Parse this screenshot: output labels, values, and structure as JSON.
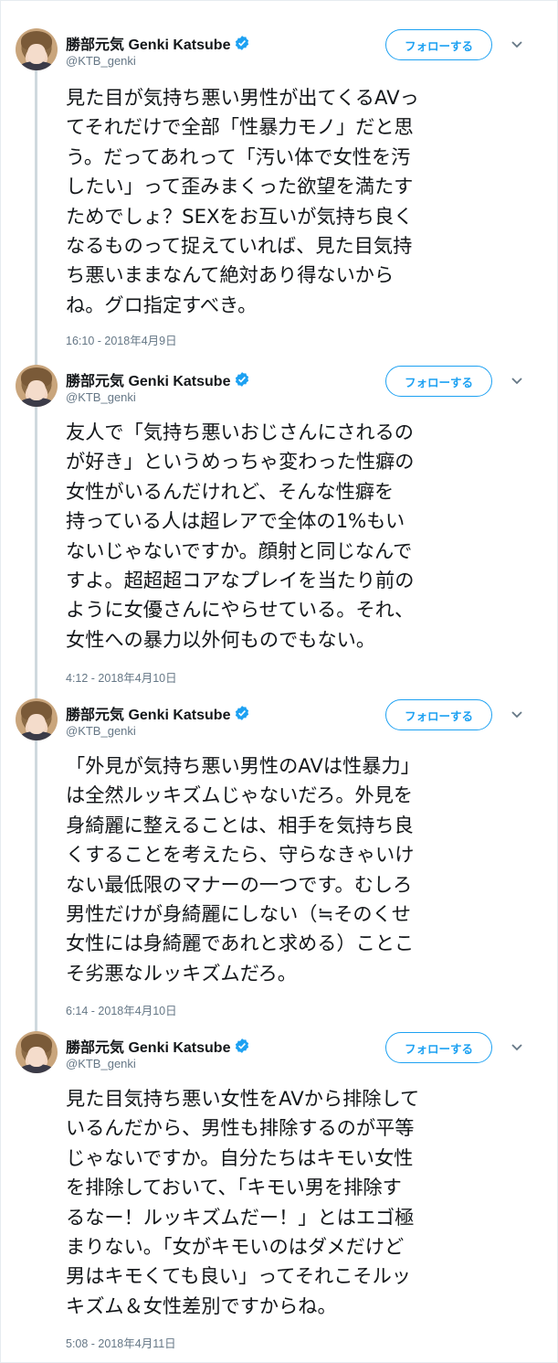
{
  "author": {
    "name": "勝部元気 Genki Katsube",
    "handle": "@KTB_genki",
    "verified": true
  },
  "follow_label": "フォローする",
  "icons": {
    "verified": "verified-badge-icon",
    "menu": "chevron-down-icon"
  },
  "colors": {
    "accent": "#1da1f2",
    "text": "#14171a",
    "muted": "#657786",
    "thread": "#cfd9de"
  },
  "tweets": [
    {
      "text": "見た目が気持ち悪い男性が出てくるAVっ\nてそれだけで全部「性暴力モノ」だと思\nう。だってあれって「汚い体で女性を汚\nしたい」って歪みまくった欲望を満たす\nためでしょ？SEXをお互いが気持ち良く\nなるものって捉えていれば、見た目気持\nち悪いままなんて絶対あり得ないから\nね。グロ指定すべき。",
      "timestamp": "16:10 - 2018年4月9日"
    },
    {
      "text": "友人で「気持ち悪いおじさんにされるの\nが好き」というめっちゃ変わった性癖の\n女性がいるんだけれど、そんな性癖を\n持っている人は超レアで全体の1%もい\nないじゃないですか。顔射と同じなんで\nすよ。超超超コアなプレイを当たり前の\nように女優さんにやらせている。それ、\n女性への暴力以外何ものでもない。",
      "timestamp": "4:12 - 2018年4月10日"
    },
    {
      "text": "「外見が気持ち悪い男性のAVは性暴力」\nは全然ルッキズムじゃないだろ。外見を\n身綺麗に整えることは、相手を気持ち良\nくすることを考えたら、守らなきゃいけ\nない最低限のマナーの一つです。むしろ\n男性だけが身綺麗にしない（≒そのくせ\n女性には身綺麗であれと求める）ことこ\nそ劣悪なルッキズムだろ。",
      "timestamp": "6:14 - 2018年4月10日"
    },
    {
      "text": "見た目気持ち悪い女性をAVから排除して\nいるんだから、男性も排除するのが平等\nじゃないですか。自分たちはキモい女性\nを排除しておいて、「キモい男を排除す\nるなー！ルッキズムだー！」とはエゴ極\nまりない。「女がキモいのはダメだけど\n男はキモくても良い」ってそれこそルッ\nキズム＆女性差別ですからね。",
      "timestamp": "5:08 - 2018年4月11日"
    }
  ]
}
